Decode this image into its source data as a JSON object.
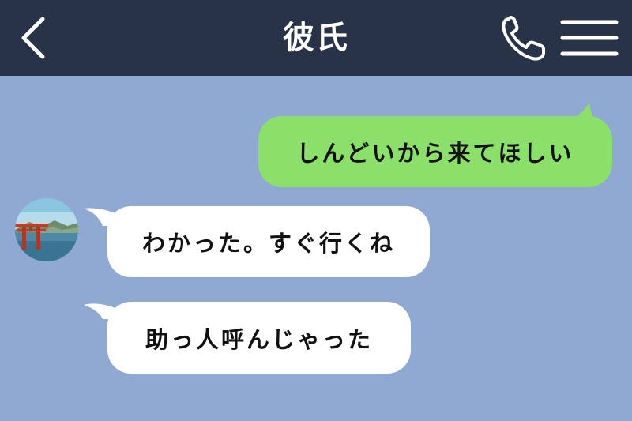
{
  "header": {
    "title": "彼氏",
    "back_icon": "chevron-left-icon",
    "call_icon": "phone-icon",
    "menu_icon": "hamburger-menu-icon"
  },
  "colors": {
    "header_bg": "#283347",
    "chat_bg": "#8FA9D3",
    "sent_bubble": "#8BE06A",
    "received_bubble": "#FFFFFF"
  },
  "messages": [
    {
      "direction": "sent",
      "text": "しんどいから来てほしい"
    },
    {
      "direction": "received",
      "text": "わかった。すぐ行くね"
    },
    {
      "direction": "received",
      "text": "助っ人呼んじゃった"
    }
  ],
  "contact": {
    "avatar_icon": "torii-gate-photo-avatar"
  }
}
